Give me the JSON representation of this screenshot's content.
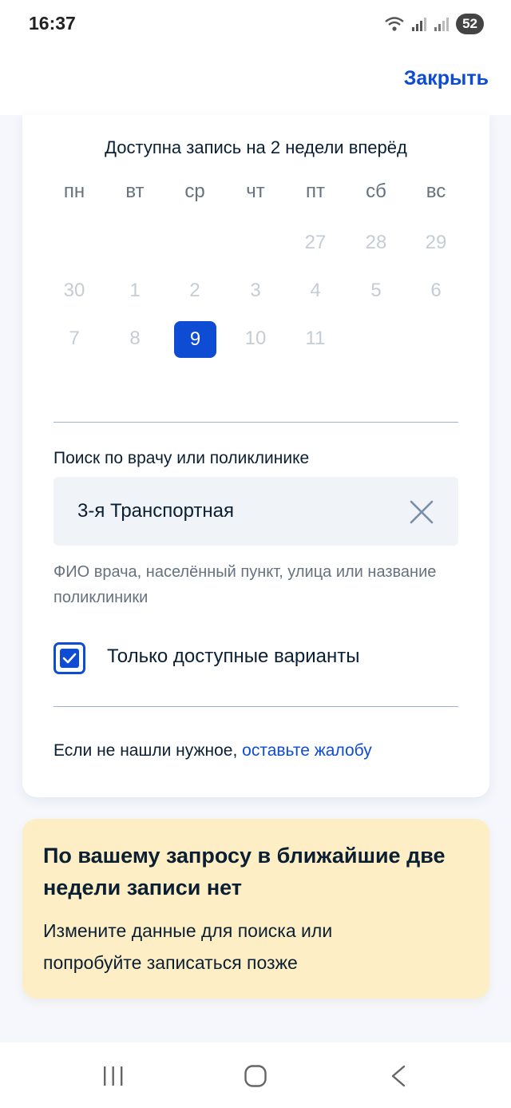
{
  "status_bar": {
    "time": "16:37",
    "battery": "52",
    "icons": [
      "wifi-icon",
      "signal-icon",
      "signal-icon"
    ]
  },
  "header": {
    "close_label": "Закрыть"
  },
  "calendar": {
    "caption": "Доступна запись на 2 недели вперёд",
    "weekdays": [
      "пн",
      "вт",
      "ср",
      "чт",
      "пт",
      "сб",
      "вс"
    ],
    "weeks": [
      [
        "",
        "",
        "",
        "",
        "27",
        "28",
        "29"
      ],
      [
        "30",
        "1",
        "2",
        "3",
        "4",
        "5",
        "6"
      ],
      [
        "7",
        "8",
        "9",
        "10",
        "11",
        "",
        ""
      ]
    ],
    "selected_day": "9"
  },
  "search": {
    "label": "Поиск по врачу или поликлинике",
    "value": "3-я Транспортная",
    "hint": "ФИО врача, населённый пункт, улица или название поликлиники"
  },
  "filter": {
    "label": "Только доступные варианты",
    "checked": true
  },
  "complaint": {
    "text": "Если не нашли нужное, ",
    "link": "оставьте жалобу"
  },
  "notice": {
    "title": "По вашему запросу в ближайшие две недели записи нет",
    "text": "Измените данные для поиска или попробуйте записаться позже"
  },
  "colors": {
    "accent": "#0d4cd3",
    "notice_bg": "#fdeec5",
    "disabled_day": "#c6ccd4"
  }
}
